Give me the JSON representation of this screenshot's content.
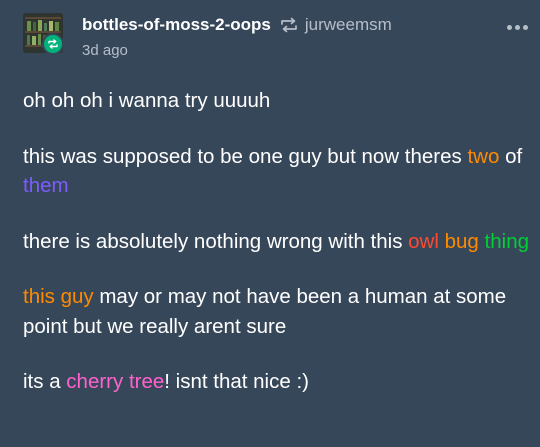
{
  "post": {
    "blog_name": "bottles-of-moss-2-oops",
    "source_name": "jurweemsm",
    "timestamp": "3d ago",
    "paragraphs": [
      {
        "text": "oh oh oh i wanna try uuuuh"
      },
      {
        "segments": [
          {
            "text": "this was supposed to be one guy but now theres ",
            "color": "white"
          },
          {
            "text": "two",
            "color": "orange"
          },
          {
            "text": " of ",
            "color": "white"
          },
          {
            "text": "them",
            "color": "purple"
          }
        ]
      },
      {
        "segments": [
          {
            "text": "there is absolutely nothing wrong with this ",
            "color": "white"
          },
          {
            "text": "owl",
            "color": "red"
          },
          {
            "text": " ",
            "color": "white"
          },
          {
            "text": "bug",
            "color": "orange"
          },
          {
            "text": " ",
            "color": "white"
          },
          {
            "text": "thing",
            "color": "green"
          }
        ]
      },
      {
        "segments": [
          {
            "text": "this guy",
            "color": "orange"
          },
          {
            "text": " may or may not have been a human at some point but we really arent sure",
            "color": "white"
          }
        ]
      },
      {
        "segments": [
          {
            "text": "its a ",
            "color": "white"
          },
          {
            "text": "cherry tree",
            "color": "pink"
          },
          {
            "text": "! isnt that nice :)",
            "color": "white"
          }
        ]
      }
    ]
  },
  "icons": {
    "reblog": "reblog-icon",
    "more": "more-options-icon",
    "badge": "reblog-badge-icon"
  },
  "colors": {
    "background": "#37475a",
    "orange": "#ff8a00",
    "purple": "#7c5cff",
    "red": "#ff4930",
    "green": "#00cf35",
    "pink": "#ff62ce",
    "badge": "#00b37a"
  }
}
